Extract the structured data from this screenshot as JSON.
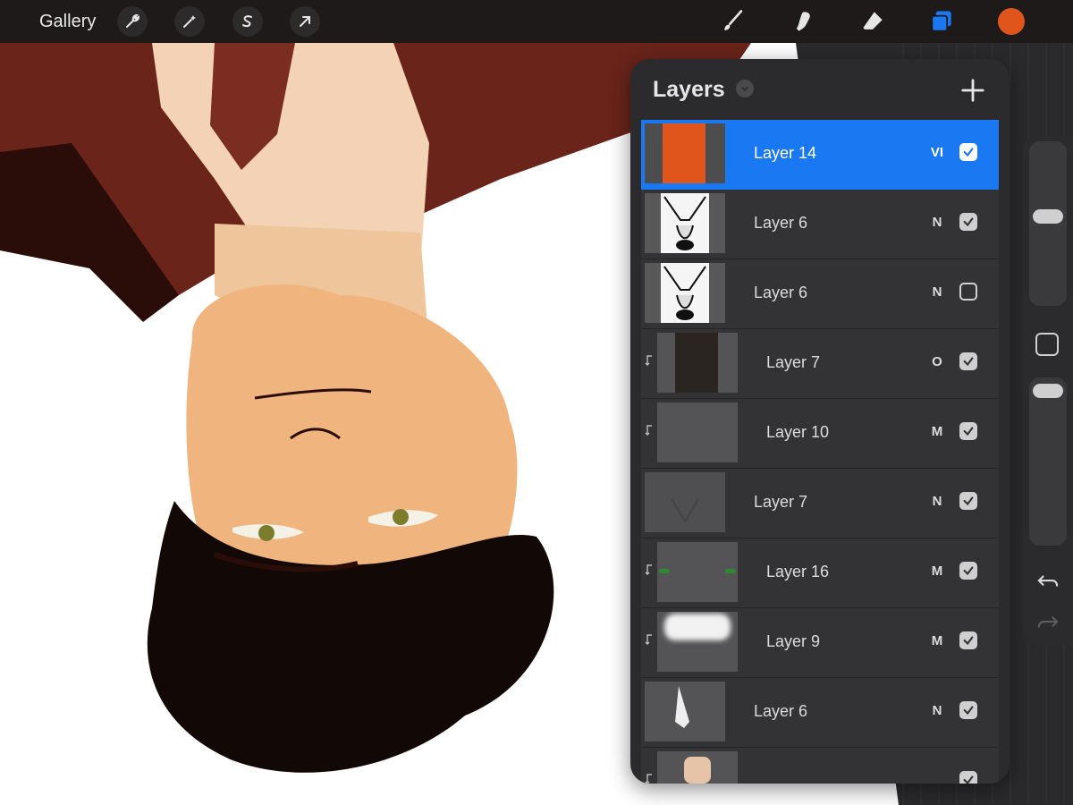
{
  "toolbar": {
    "gallery_label": "Gallery",
    "left_tools": [
      "wrench-icon",
      "magic-wand-icon",
      "selection-s-icon",
      "transform-arrow-icon"
    ],
    "right_tools": [
      "brush-icon",
      "smudge-icon",
      "eraser-icon",
      "layers-icon"
    ],
    "layers_tool_color": "#1a78f2",
    "current_color": "#e0551c"
  },
  "layers_panel": {
    "title": "Layers",
    "add_icon": "plus-icon",
    "selected_color": "#1a78f2",
    "layers": [
      {
        "name": "Layer 14",
        "blend": "VI",
        "visible": true,
        "selected": true,
        "clipped": false,
        "thumb": "orange-rect"
      },
      {
        "name": "Layer 6",
        "blend": "N",
        "visible": true,
        "selected": false,
        "clipped": false,
        "thumb": "sketch"
      },
      {
        "name": "Layer 6",
        "blend": "N",
        "visible": false,
        "selected": false,
        "clipped": false,
        "thumb": "sketch"
      },
      {
        "name": "Layer 7",
        "blend": "O",
        "visible": true,
        "selected": false,
        "clipped": true,
        "thumb": "dark-rect"
      },
      {
        "name": "Layer 10",
        "blend": "M",
        "visible": true,
        "selected": false,
        "clipped": true,
        "thumb": "gray"
      },
      {
        "name": "Layer 7",
        "blend": "N",
        "visible": true,
        "selected": false,
        "clipped": false,
        "thumb": "collar"
      },
      {
        "name": "Layer 16",
        "blend": "M",
        "visible": true,
        "selected": false,
        "clipped": true,
        "thumb": "green-dots"
      },
      {
        "name": "Layer 9",
        "blend": "M",
        "visible": true,
        "selected": false,
        "clipped": true,
        "thumb": "white-blur"
      },
      {
        "name": "Layer 6",
        "blend": "N",
        "visible": true,
        "selected": false,
        "clipped": false,
        "thumb": "shirt"
      },
      {
        "name": "",
        "blend": "",
        "visible": true,
        "selected": false,
        "clipped": true,
        "thumb": "skin"
      }
    ]
  },
  "sidebar": {
    "brush_size_level": 0.55,
    "opacity_level": 0.98,
    "modify_icon": "square-modify-icon",
    "undo_icon": "undo-arrow-icon",
    "redo_icon": "redo-arrow-icon"
  }
}
